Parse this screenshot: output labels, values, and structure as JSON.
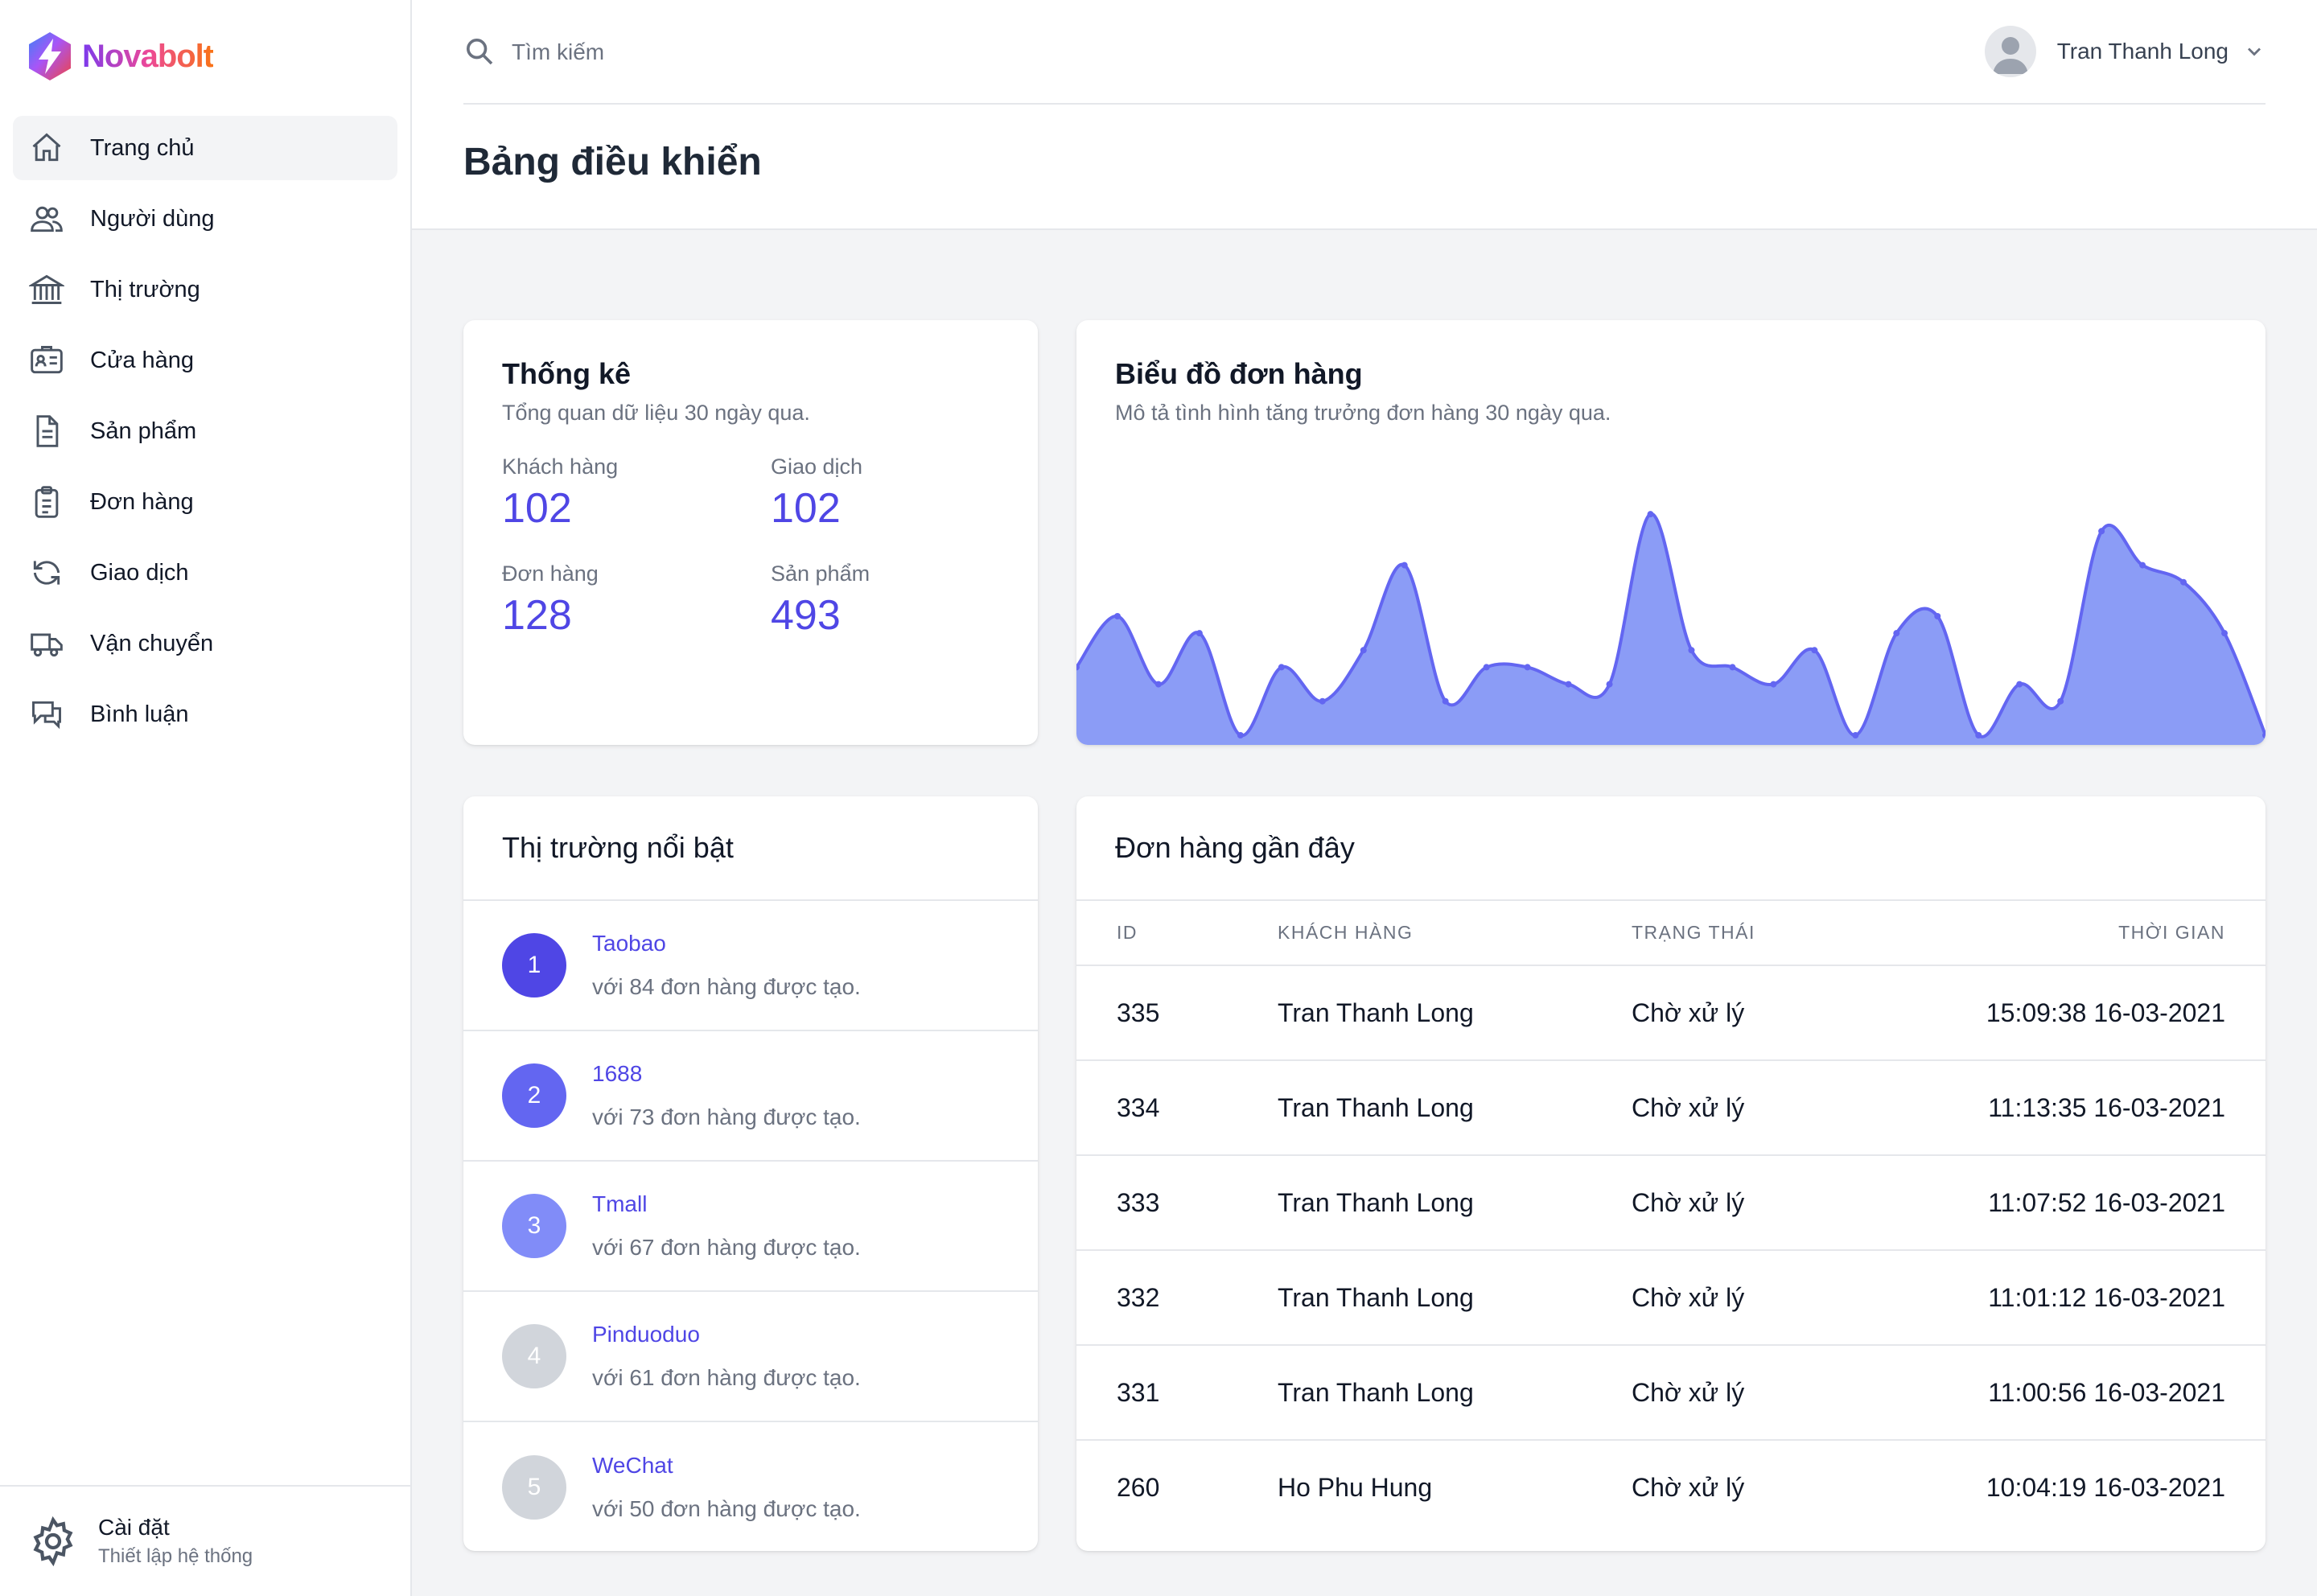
{
  "brand": {
    "name": "Novabolt"
  },
  "sidebar": {
    "items": [
      {
        "label": "Trang chủ",
        "icon": "home-icon",
        "active": true
      },
      {
        "label": "Người dùng",
        "icon": "users-icon",
        "active": false
      },
      {
        "label": "Thị trường",
        "icon": "bank-icon",
        "active": false
      },
      {
        "label": "Cửa hàng",
        "icon": "id-card-icon",
        "active": false
      },
      {
        "label": "Sản phẩm",
        "icon": "document-icon",
        "active": false
      },
      {
        "label": "Đơn hàng",
        "icon": "clipboard-list-icon",
        "active": false
      },
      {
        "label": "Giao dịch",
        "icon": "refresh-icon",
        "active": false
      },
      {
        "label": "Vận chuyển",
        "icon": "truck-icon",
        "active": false
      },
      {
        "label": "Bình luận",
        "icon": "chat-icon",
        "active": false
      }
    ],
    "settings": {
      "title": "Cài đặt",
      "subtitle": "Thiết lập hệ thống",
      "icon": "gear-icon"
    }
  },
  "header": {
    "search_placeholder": "Tìm kiếm",
    "user_name": "Tran Thanh Long",
    "page_title": "Bảng điều khiển"
  },
  "stats": {
    "title": "Thống kê",
    "subtitle": "Tổng quan dữ liệu 30 ngày qua.",
    "items": [
      {
        "label": "Khách hàng",
        "value": "102"
      },
      {
        "label": "Giao dịch",
        "value": "102"
      },
      {
        "label": "Đơn hàng",
        "value": "128"
      },
      {
        "label": "Sản phẩm",
        "value": "493"
      }
    ]
  },
  "order_chart": {
    "title": "Biểu đồ đơn hàng",
    "subtitle": "Mô tả tình hình tăng trưởng đơn hàng 30 ngày qua."
  },
  "chart_data": {
    "type": "area",
    "title": "Biểu đồ đơn hàng",
    "x": [
      1,
      2,
      3,
      4,
      5,
      6,
      7,
      8,
      9,
      10,
      11,
      12,
      13,
      14,
      15,
      16,
      17,
      18,
      19,
      20,
      21,
      22,
      23,
      24,
      25,
      26,
      27,
      28,
      29,
      30
    ],
    "values": [
      4,
      7,
      3,
      6,
      0,
      4,
      2,
      5,
      10,
      2,
      4,
      4,
      3,
      3,
      13,
      5,
      4,
      3,
      5,
      0,
      6,
      7,
      0,
      3,
      2,
      12,
      10,
      9,
      6,
      0
    ],
    "ylim": [
      0,
      14
    ],
    "color": "#6366f1",
    "fill": "#8b9cf6",
    "grid": false,
    "legend": "none"
  },
  "markets": {
    "title": "Thị trường nổi bật",
    "items": [
      {
        "rank": "1",
        "name": "Taobao",
        "desc": "với 84 đơn hàng được tạo.",
        "color": "#4f46e5"
      },
      {
        "rank": "2",
        "name": "1688",
        "desc": "với 73 đơn hàng được tạo.",
        "color": "#6366f1"
      },
      {
        "rank": "3",
        "name": "Tmall",
        "desc": "với 67 đơn hàng được tạo.",
        "color": "#818cf8"
      },
      {
        "rank": "4",
        "name": "Pinduoduo",
        "desc": "với 61 đơn hàng được tạo.",
        "color": "#d1d5db"
      },
      {
        "rank": "5",
        "name": "WeChat",
        "desc": "với 50 đơn hàng được tạo.",
        "color": "#d1d5db"
      }
    ]
  },
  "recent_orders": {
    "title": "Đơn hàng gần đây",
    "columns": [
      "ID",
      "KHÁCH HÀNG",
      "TRẠNG THÁI",
      "THỜI GIAN"
    ],
    "rows": [
      [
        "335",
        "Tran Thanh Long",
        "Chờ xử lý",
        "15:09:38 16-03-2021"
      ],
      [
        "334",
        "Tran Thanh Long",
        "Chờ xử lý",
        "11:13:35 16-03-2021"
      ],
      [
        "333",
        "Tran Thanh Long",
        "Chờ xử lý",
        "11:07:52 16-03-2021"
      ],
      [
        "332",
        "Tran Thanh Long",
        "Chờ xử lý",
        "11:01:12 16-03-2021"
      ],
      [
        "331",
        "Tran Thanh Long",
        "Chờ xử lý",
        "11:00:56 16-03-2021"
      ],
      [
        "260",
        "Ho Phu Hung",
        "Chờ xử lý",
        "10:04:19 16-03-2021"
      ]
    ]
  }
}
